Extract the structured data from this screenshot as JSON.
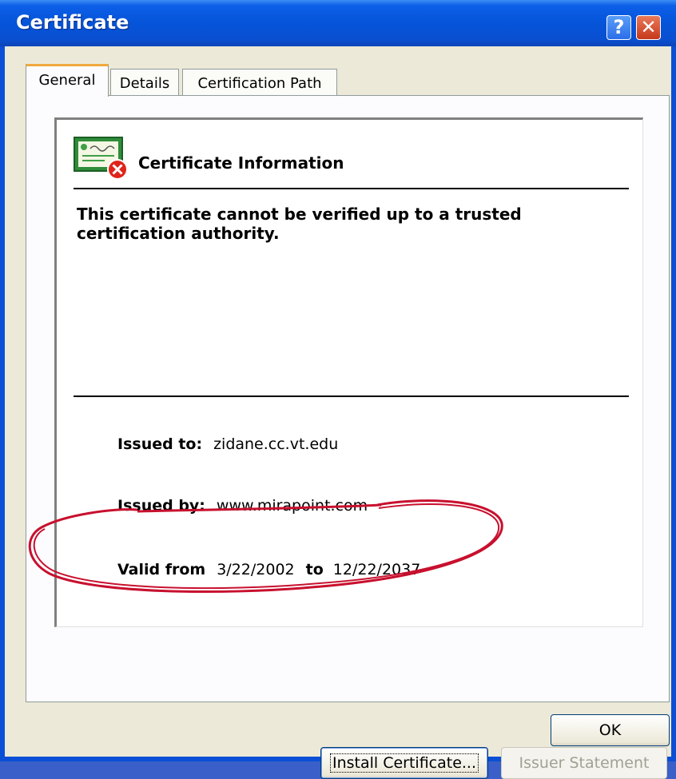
{
  "window": {
    "title": "Certificate",
    "help_glyph": "?",
    "close_glyph": "✕"
  },
  "tabs": [
    {
      "label": "General",
      "active": true
    },
    {
      "label": "Details",
      "active": false
    },
    {
      "label": "Certification Path",
      "active": false
    }
  ],
  "info": {
    "heading": "Certificate Information",
    "warning": "This certificate cannot be verified up to a trusted certification authority.",
    "issued_to_label": "Issued to:",
    "issued_to_value": "zidane.cc.vt.edu",
    "issued_by_label": "Issued by:",
    "issued_by_value": "www.mirapoint.com",
    "valid_from_label": "Valid from",
    "valid_from_value": "3/22/2002",
    "valid_to_label": "to",
    "valid_to_value": "12/22/2037"
  },
  "buttons": {
    "install": "Install Certificate...",
    "issuer": "Issuer Statement",
    "ok": "OK"
  },
  "icons": {
    "certificate": "certificate-error-icon"
  },
  "colors": {
    "titlebar": "#0554d9",
    "annotation": "#c8102e",
    "tab_highlight": "#f1a83e"
  }
}
